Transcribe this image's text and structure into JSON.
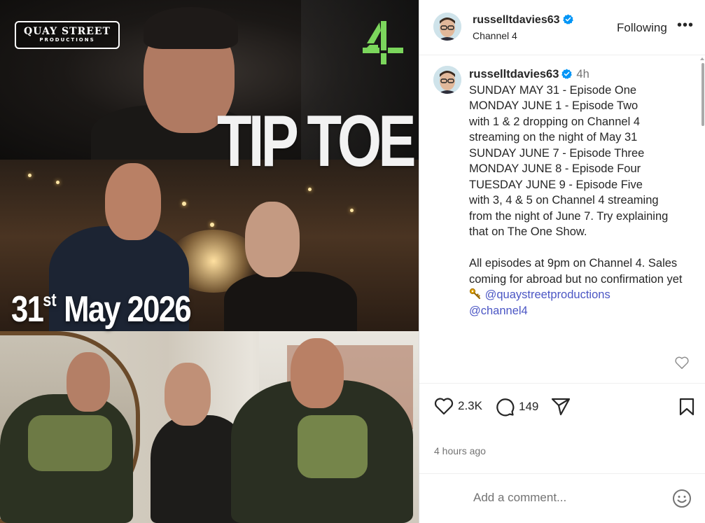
{
  "media": {
    "producer_logo_line1": "QUAY STREET",
    "producer_logo_line2": "PRODUCTIONS",
    "broadcaster_logo": "Channel 4 logo",
    "show_title": "TIP TOE",
    "release_day": "31",
    "release_suffix": "st",
    "release_rest": "May 2026"
  },
  "header": {
    "username": "russelltdavies63",
    "subtitle": "Channel 4",
    "follow_label": "Following",
    "more_label": "•••"
  },
  "caption": {
    "username": "russelltdavies63",
    "time": "4h",
    "lines": [
      "SUNDAY MAY 31 - Episode One",
      "MONDAY JUNE 1 - Episode Two",
      "with 1 & 2 dropping on Channel 4",
      "streaming on the night of May 31",
      "SUNDAY JUNE 7 - Episode Three",
      "MONDAY JUNE 8 - Episode Four",
      "TUESDAY JUNE 9 - Episode Five",
      "with 3, 4 & 5 on Channel 4 streaming",
      "from the night of June 7. Try explaining",
      "that on The One Show."
    ],
    "para2_text": "All episodes at 9pm on Channel 4. Sales coming for abroad but no confirmation yet",
    "mention1": "@quaystreetproductions",
    "mention2": "@channel4"
  },
  "actions": {
    "likes": "2.3K",
    "comments": "149"
  },
  "time_ago": "4 hours ago",
  "comment_box": {
    "placeholder": "Add a comment..."
  },
  "colors": {
    "mention": "#4b56c4",
    "verified": "#0095f6",
    "channel4_green": "#7bd65c"
  }
}
